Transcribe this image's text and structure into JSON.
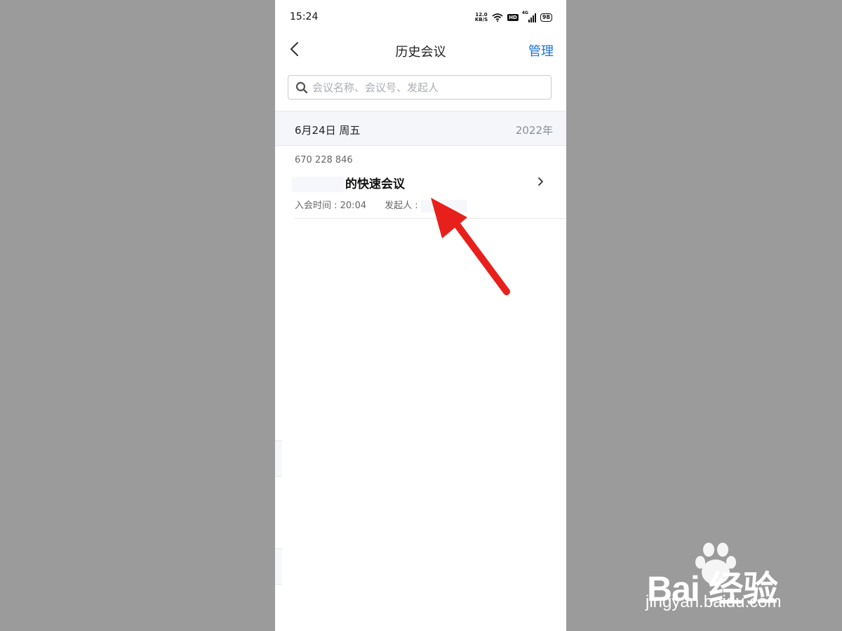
{
  "status_bar": {
    "time": "15:24",
    "net_speed_value": "12.0",
    "net_speed_unit": "KB/S",
    "hd": "HD",
    "signal_type": "4G",
    "battery": "98",
    "icons": [
      "wifi-icon",
      "hd-icon",
      "signal-icon",
      "battery-icon"
    ]
  },
  "nav": {
    "title": "历史会议",
    "manage_label": "管理",
    "back_icon": "chevron-left-icon"
  },
  "search": {
    "placeholder": "会议名称、会议号、发起人",
    "value": ""
  },
  "date_group": {
    "date": "6月24日 周五",
    "year": "2022年"
  },
  "meeting": {
    "id": "670 228 846",
    "title": "的快速会议",
    "join_time": "入会时间 : 20:04",
    "host_label": "发起人 :"
  },
  "watermark": {
    "brand": "Bai 经验",
    "url": "jingyan.baidu.com"
  },
  "colors": {
    "accent": "#1a73d9",
    "arrow": "#e8201c",
    "page_bg": "#9b9b9b"
  }
}
